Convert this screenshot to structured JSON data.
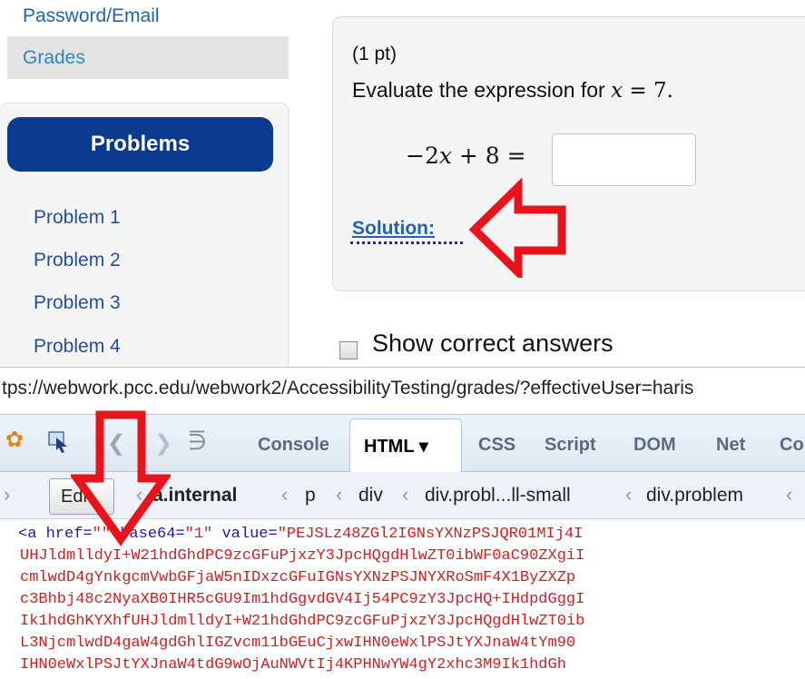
{
  "sidebar": {
    "items": [
      {
        "label": "Password/Email"
      },
      {
        "label": "Grades"
      }
    ],
    "problems_title": "Problems",
    "problems": [
      "Problem 1",
      "Problem 2",
      "Problem 3",
      "Problem 4"
    ]
  },
  "problem": {
    "points": "(1 pt)",
    "instruction_prefix": "Evaluate the expression for ",
    "instruction_var": "x",
    "instruction_eq": " = 7.",
    "expr_minus2": "−2",
    "expr_x": "x",
    "expr_rest": " + 8 =",
    "answer_value": "",
    "solution_link": "Solution:"
  },
  "show_answers": {
    "label": "Show correct answers",
    "checked": false
  },
  "url": "tps://webwork.pcc.edu/webwork2/AccessibilityTesting/grades/?effectiveUser=haris",
  "firebug": {
    "tabs": [
      "Console",
      "HTML ▾",
      "CSS",
      "Script",
      "DOM",
      "Net",
      "Co"
    ],
    "active_tab": "HTML ▾",
    "edit_label": "Edit",
    "breadcrumbs": [
      "a.internal",
      "p",
      "div",
      "div.probl...ll-small",
      "div.problem"
    ],
    "code": {
      "line1_tag": "<a href=",
      "line1_href": "\"\"",
      "line1_base_attr": " base64=",
      "line1_base_val": "\"1\"",
      "line1_value_attr": " value=",
      "line1_value_val": "\"PEJSLz48ZGl2IGNsYXNzPSJQR01MIj4I",
      "lines": [
        "UHJldmlldyI+W21hdGhdPC9zcGFuPjxzY3JpcHQgdHlwZT0ibWF0aC90ZXgiI",
        "cmlwdD4gYnkgcmVwbGFjaW5nIDxzcGFuIGNsYXNzPSJNYXRoSmF4X1ByZXZp",
        "c3Bhbj48c2NyaXB0IHR5cGU9Im1hdGgvdGV4Ij54PC9zY3JpcHQ+IHdpdGggI",
        "Ik1hdGhKYXhfUHJldmlldyI+W21hdGhdPC9zcGFuPjxzY3JpcHQgdHlwZT0ib",
        "L3NjcmlwdD4gaW4gdGhlIGZvcm11bGEuCjxwIHN0eWxlPSJtYXJnaW4tYm90",
        "IHN0eWxlPSJtYXJnaW4tdG9wOjAuNWVtIj4KPHNwYW4gY2xhc3M9Ik1hdGh"
      ]
    }
  }
}
